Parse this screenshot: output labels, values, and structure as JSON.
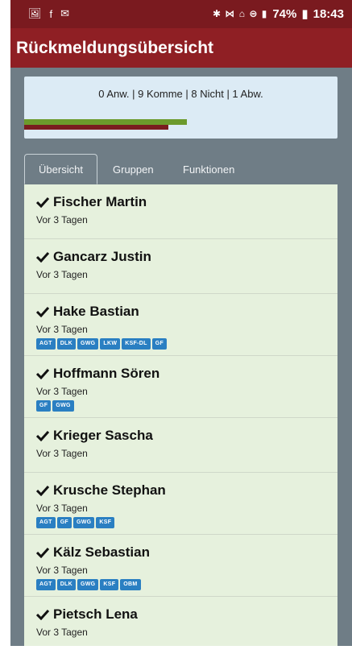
{
  "status_bar": {
    "left_icons": [
      "image-icon",
      "facebook-icon",
      "mail-icon"
    ],
    "right_text": "74%",
    "time": "18:43"
  },
  "app": {
    "title": "Rückmeldungsübersicht"
  },
  "summary": {
    "text": "0 Anw. | 9 Komme | 8 Nicht | 1 Abw.",
    "bars": {
      "green_fraction": 0.52,
      "red_fraction": 0.46
    },
    "colors": {
      "green": "#6c9a2c",
      "red": "#7a1c1f"
    }
  },
  "tabs": [
    {
      "label": "Übersicht",
      "active": true
    },
    {
      "label": "Gruppen",
      "active": false
    },
    {
      "label": "Funktionen",
      "active": false
    }
  ],
  "people": [
    {
      "name": "Fischer Martin",
      "when": "Vor 3 Tagen",
      "badges": []
    },
    {
      "name": "Gancarz Justin",
      "when": "Vor 3 Tagen",
      "badges": []
    },
    {
      "name": "Hake Bastian",
      "when": "Vor 3 Tagen",
      "badges": [
        "AGT",
        "DLK",
        "GWG",
        "LKW",
        "KSF-DL",
        "GF"
      ]
    },
    {
      "name": "Hoffmann Sören",
      "when": "Vor 3 Tagen",
      "badges": [
        "GF",
        "GWG"
      ]
    },
    {
      "name": "Krieger Sascha",
      "when": "Vor 3 Tagen",
      "badges": []
    },
    {
      "name": "Krusche Stephan",
      "when": "Vor 3 Tagen",
      "badges": [
        "AGT",
        "GF",
        "GWG",
        "KSF"
      ]
    },
    {
      "name": "Kälz Sebastian",
      "when": "Vor 3 Tagen",
      "badges": [
        "AGT",
        "DLK",
        "GWG",
        "KSF",
        "OBM"
      ]
    },
    {
      "name": "Pietsch Lena",
      "when": "Vor 3 Tagen",
      "badges": []
    }
  ],
  "colors": {
    "appbar": "#8f1f24",
    "background": "#6f7d86",
    "list_bg": "#e6f1dd",
    "badge": "#2a7fc2"
  }
}
